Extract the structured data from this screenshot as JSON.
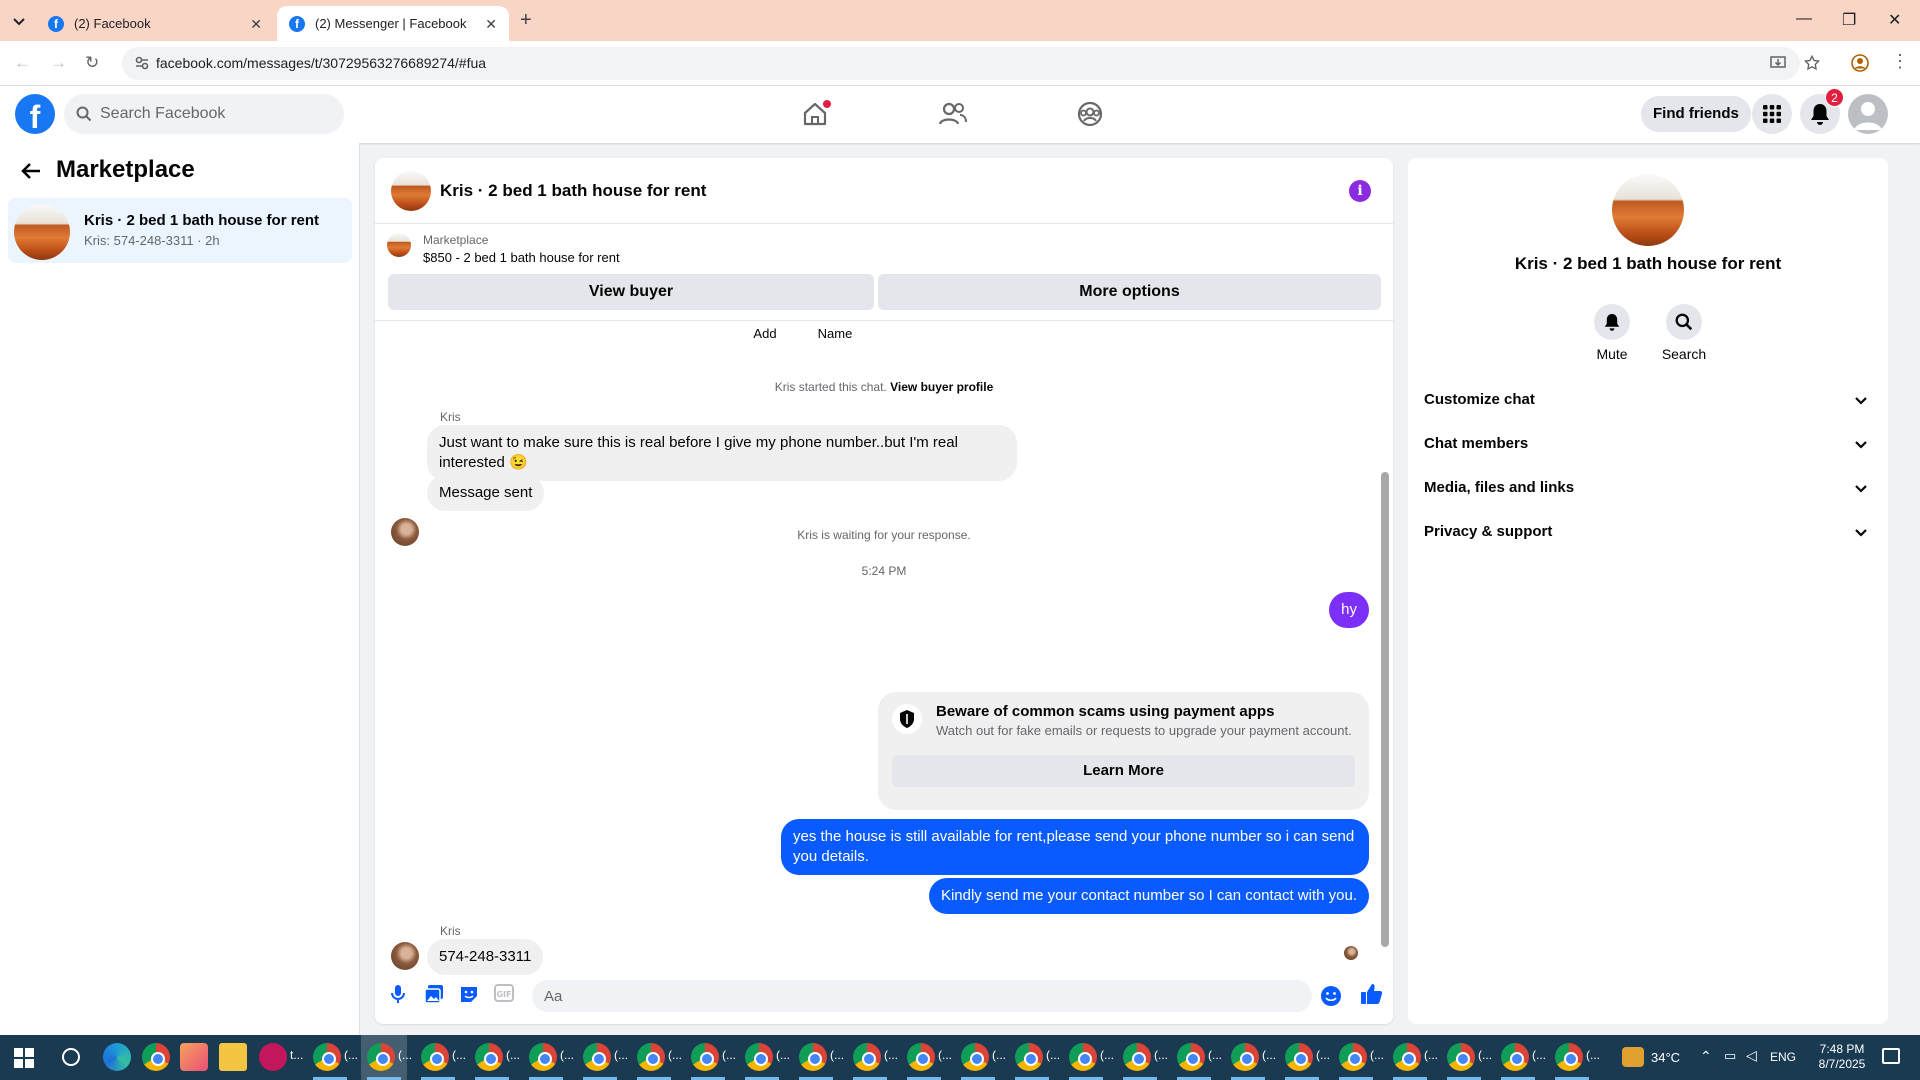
{
  "browser": {
    "tabs": [
      {
        "label": "(2) Facebook",
        "active": false
      },
      {
        "label": "(2) Messenger | Facebook",
        "active": true
      }
    ],
    "url": "facebook.com/messages/t/30729563276689274/#fua"
  },
  "fb_header": {
    "search_placeholder": "Search Facebook",
    "find_friends_label": "Find friends",
    "notification_count": "2",
    "nav_icons": [
      "home-icon",
      "friends-icon",
      "groups-icon"
    ]
  },
  "left_panel": {
    "title": "Marketplace",
    "conversation": {
      "name": "Kris · 2 bed 1 bath house for rent",
      "meta": "Kris: 574-248-3311 · 2h"
    }
  },
  "chat": {
    "title": "Kris · 2 bed 1 bath house for rent",
    "marketplace_label": "Marketplace",
    "listing": "$850 - 2 bed 1 bath house for rent",
    "view_buyer_label": "View buyer",
    "more_options_label": "More options",
    "add_label": "Add",
    "name_label": "Name",
    "started_text": "Kris started this chat.",
    "view_buyer_profile": "View buyer profile",
    "sender_name": "Kris",
    "msg1": "Just want to make sure this is real before I give my phone number..but I'm real interested 😉",
    "msg2": "Message sent",
    "waiting_text": "Kris is waiting for your response.",
    "timestamp": "5:24 PM",
    "out1": "hy",
    "scam_title": "Beware of common scams using payment apps",
    "scam_sub": "Watch out for fake emails or requests to upgrade your payment account.",
    "learn_more": "Learn More",
    "out2": "yes the house is still available for rent,please send your phone number so i can send you details.",
    "out3": "Kindly send me your contact number so I can contact with you.",
    "sender_name2": "Kris",
    "msg3": "574-248-3311",
    "composer_placeholder": "Aa",
    "accent": "#0a5bff"
  },
  "right_panel": {
    "name": "Kris · 2 bed 1 bath house for rent",
    "mute_label": "Mute",
    "search_label": "Search",
    "sections": [
      "Customize chat",
      "Chat members",
      "Media, files and links",
      "Privacy & support"
    ]
  },
  "taskbar": {
    "app_label": "(...",
    "first_label": "t...",
    "temperature": "34°C",
    "language": "ENG",
    "time": "7:48 PM",
    "date": "8/7/2025"
  }
}
